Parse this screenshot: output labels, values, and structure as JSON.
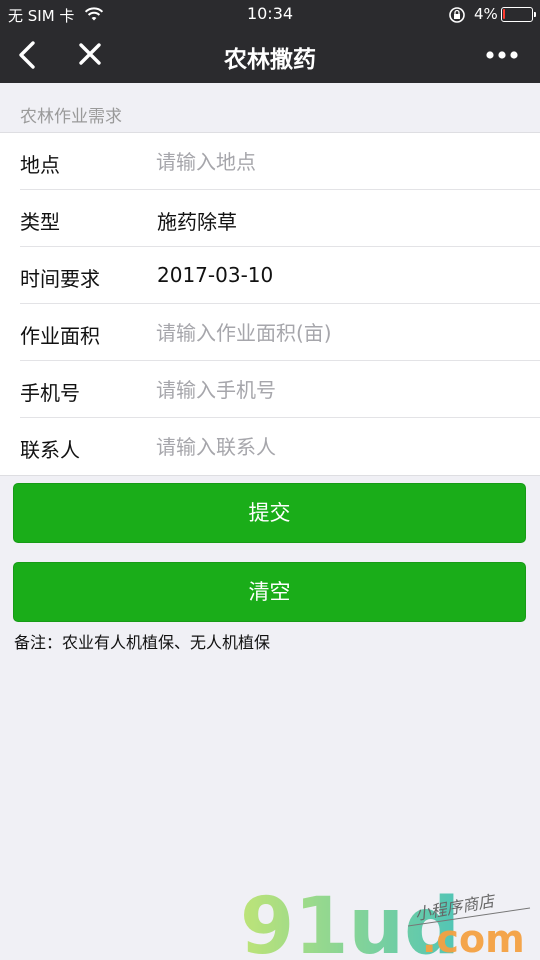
{
  "status_bar": {
    "carrier": "无 SIM 卡",
    "time": "10:34",
    "battery": "4%",
    "battery_level": 0.04,
    "icons": [
      "wifi-icon",
      "rotation-lock-icon",
      "battery-icon"
    ]
  },
  "nav": {
    "title": "农林撒药",
    "back_icon": "chevron-left-icon",
    "close_icon": "close-icon",
    "more_icon": "more-icon"
  },
  "section": {
    "title": "农林作业需求"
  },
  "form": {
    "location": {
      "label": "地点",
      "placeholder": "请输入地点",
      "value": ""
    },
    "type": {
      "label": "类型",
      "value": "施药除草"
    },
    "time": {
      "label": "时间要求",
      "value": "2017-03-10"
    },
    "area": {
      "label": "作业面积",
      "placeholder": "请输入作业面积(亩)",
      "value": ""
    },
    "phone": {
      "label": "手机号",
      "placeholder": "请输入手机号",
      "value": ""
    },
    "contact": {
      "label": "联系人",
      "placeholder": "请输入联系人",
      "value": ""
    }
  },
  "buttons": {
    "submit": "提交",
    "clear": "清空"
  },
  "note": "备注：农业有人机植保、无人机植保",
  "watermark": {
    "brand": "91ud",
    "domain": ".com",
    "tagline": "小程序商店"
  },
  "colors": {
    "bar_bg": "#2b2b2e",
    "accent_green": "#1aad19",
    "page_bg": "#f0f0f5"
  }
}
